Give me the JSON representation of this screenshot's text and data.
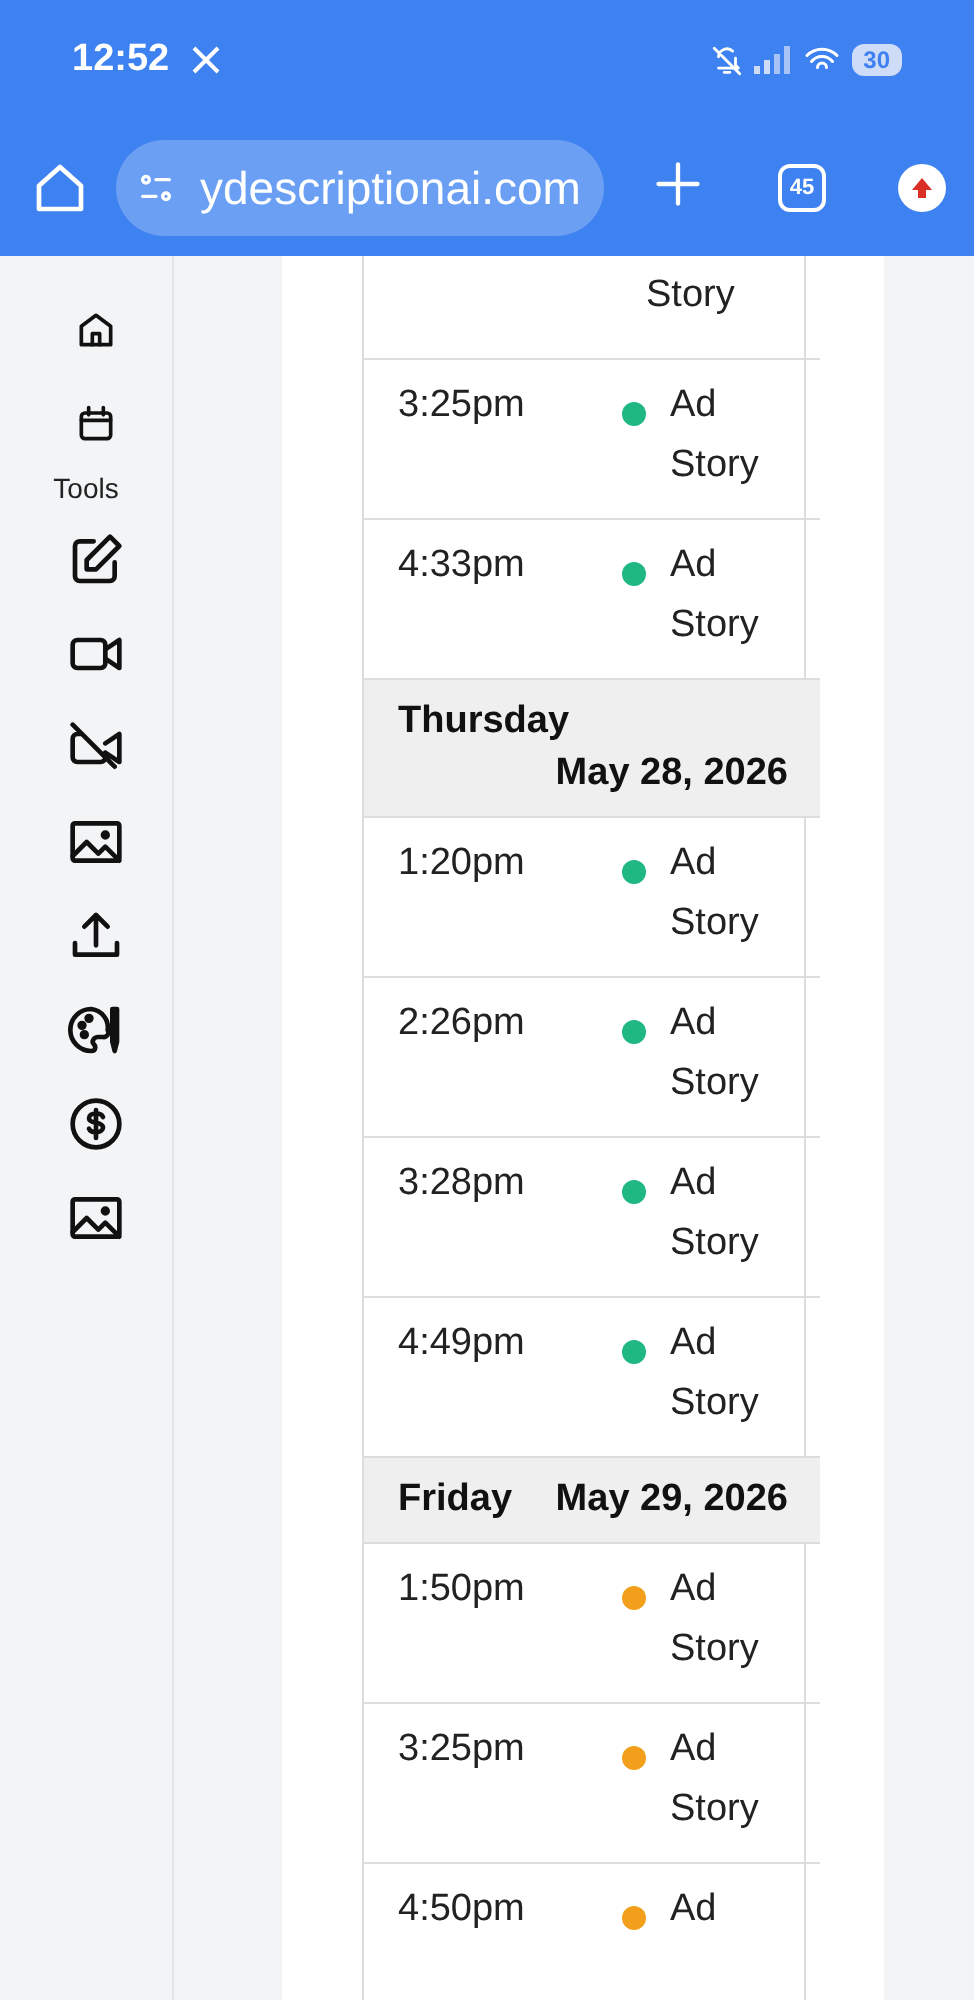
{
  "status_bar": {
    "time": "12:52",
    "battery": "30"
  },
  "browser": {
    "url": "ydescriptionai.com",
    "tab_count": "45"
  },
  "sidebar": {
    "section_label": "Tools"
  },
  "schedule": [
    {
      "kind": "partial",
      "text": "Story"
    },
    {
      "kind": "slot",
      "time": "3:25pm",
      "color": "#1fb882",
      "title": "Ad Story"
    },
    {
      "kind": "slot",
      "time": "4:33pm",
      "color": "#1fb882",
      "title": "Ad Story"
    },
    {
      "kind": "day",
      "day": "Thursday",
      "date": "May 28, 2026"
    },
    {
      "kind": "slot",
      "time": "1:20pm",
      "color": "#1fb882",
      "title": "Ad Story"
    },
    {
      "kind": "slot",
      "time": "2:26pm",
      "color": "#1fb882",
      "title": "Ad Story"
    },
    {
      "kind": "slot",
      "time": "3:28pm",
      "color": "#1fb882",
      "title": "Ad Story"
    },
    {
      "kind": "slot",
      "time": "4:49pm",
      "color": "#1fb882",
      "title": "Ad Story"
    },
    {
      "kind": "day",
      "day": "Friday",
      "date": "May 29, 2026"
    },
    {
      "kind": "slot",
      "time": "1:50pm",
      "color": "#f2a01c",
      "title": "Ad Story"
    },
    {
      "kind": "slot",
      "time": "3:25pm",
      "color": "#f2a01c",
      "title": "Ad Story"
    },
    {
      "kind": "slot",
      "time": "4:50pm",
      "color": "#f2a01c",
      "title": "Ad"
    }
  ]
}
